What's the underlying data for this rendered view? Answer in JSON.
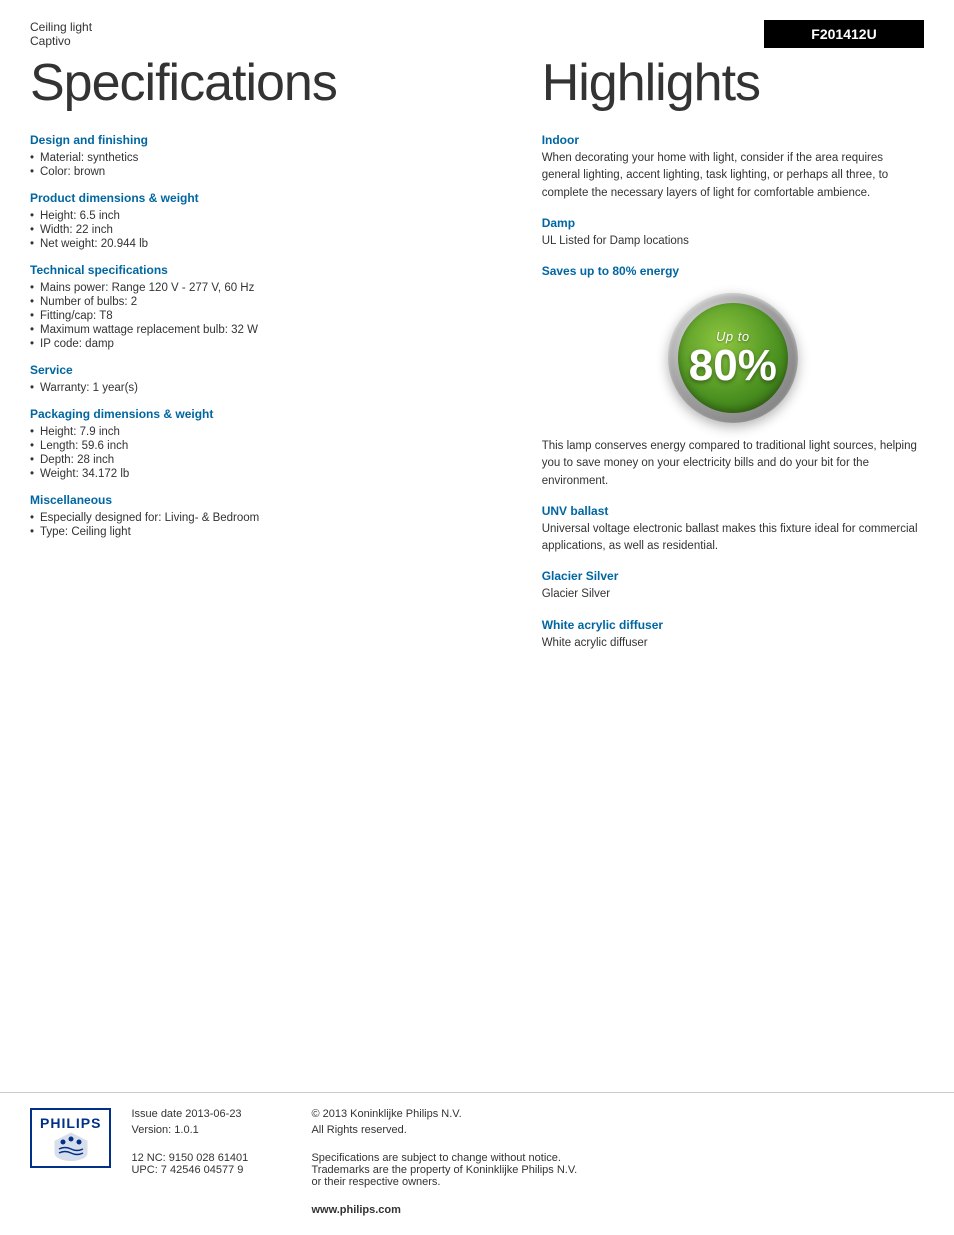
{
  "header": {
    "product_type": "Ceiling light",
    "product_name": "Captivo",
    "model_number": "F201412U"
  },
  "page_title": "Specifications",
  "highlights_title": "Highlights",
  "specifications": {
    "design_finishing": {
      "title": "Design and finishing",
      "items": [
        "Material: synthetics",
        "Color: brown"
      ]
    },
    "product_dimensions": {
      "title": "Product dimensions & weight",
      "items": [
        "Height: 6.5 inch",
        "Width: 22 inch",
        "Net weight: 20.944 lb"
      ]
    },
    "technical_specs": {
      "title": "Technical specifications",
      "items": [
        "Mains power: Range 120 V - 277 V, 60 Hz",
        "Number of bulbs: 2",
        "Fitting/cap: T8",
        "Maximum wattage replacement bulb: 32 W",
        "IP code: damp"
      ]
    },
    "service": {
      "title": "Service",
      "items": [
        "Warranty: 1 year(s)"
      ]
    },
    "packaging_dimensions": {
      "title": "Packaging dimensions & weight",
      "items": [
        "Height: 7.9 inch",
        "Length: 59.6 inch",
        "Depth: 28 inch",
        "Weight: 34.172 lb"
      ]
    },
    "miscellaneous": {
      "title": "Miscellaneous",
      "items": [
        "Especially designed for: Living- & Bedroom",
        "Type: Ceiling light"
      ]
    }
  },
  "highlights": {
    "indoor": {
      "title": "Indoor",
      "text": "When decorating your home with light, consider if the area requires general lighting, accent lighting, task lighting, or perhaps all three, to complete the necessary layers of light for comfortable ambience."
    },
    "damp": {
      "title": "Damp",
      "text": "UL Listed for Damp locations"
    },
    "energy_saving": {
      "title": "Saves up to 80% energy",
      "badge_up_to": "Up to",
      "badge_percent": "80%",
      "description": "This lamp conserves energy compared to traditional light sources, helping you to save money on your electricity bills and do your bit for the environment."
    },
    "unv_ballast": {
      "title": "UNV ballast",
      "text": "Universal voltage electronic ballast makes this fixture ideal for commercial applications, as well as residential."
    },
    "glacier_silver": {
      "title": "Glacier Silver",
      "text": "Glacier Silver"
    },
    "white_acrylic_diffuser": {
      "title": "White acrylic diffuser",
      "text": "White acrylic diffuser"
    }
  },
  "footer": {
    "issue_date_label": "Issue date 2013-06-23",
    "version_label": "Version: 1.0.1",
    "nc_upc": "12 NC: 9150 028 61401\nUPC: 7 42546 04577 9",
    "copyright": "© 2013 Koninklijke Philips N.V.",
    "rights": "All Rights reserved.",
    "disclaimer": "Specifications are subject to change without notice.\nTrademarks are the property of Koninklijke Philips N.V.\nor their respective owners.",
    "website": "www.philips.com"
  }
}
